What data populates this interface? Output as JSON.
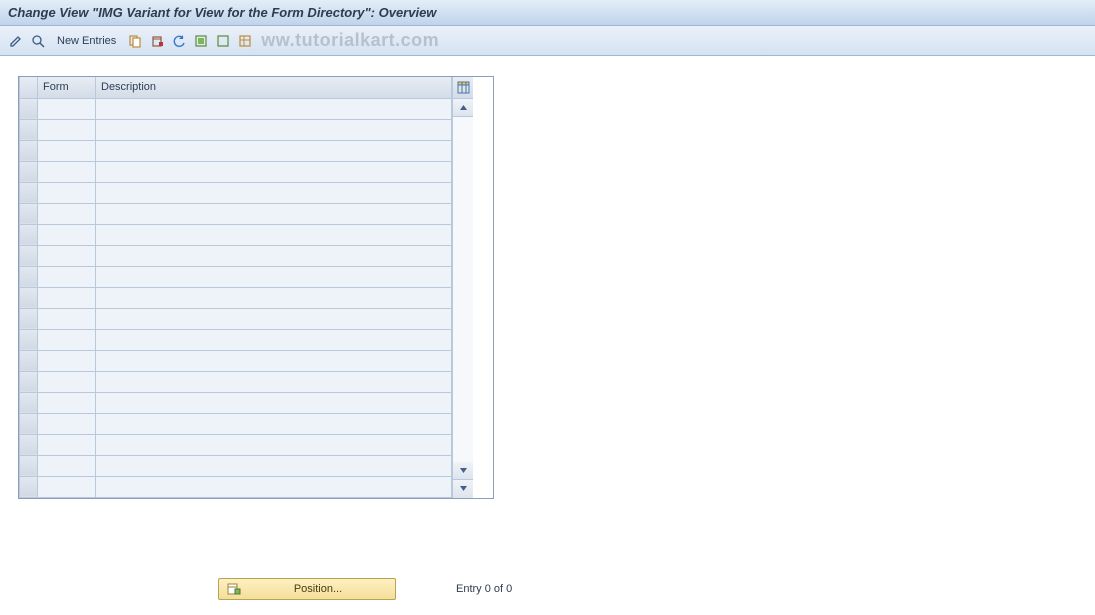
{
  "title": "Change View \"IMG Variant for View for the Form Directory\": Overview",
  "toolbar": {
    "new_entries_label": "New Entries"
  },
  "watermark": "ww.tutorialkart.com",
  "table": {
    "headers": {
      "form": "Form",
      "description": "Description"
    },
    "row_count": 19
  },
  "footer": {
    "position_label": "Position...",
    "entry_text": "Entry 0 of 0"
  }
}
